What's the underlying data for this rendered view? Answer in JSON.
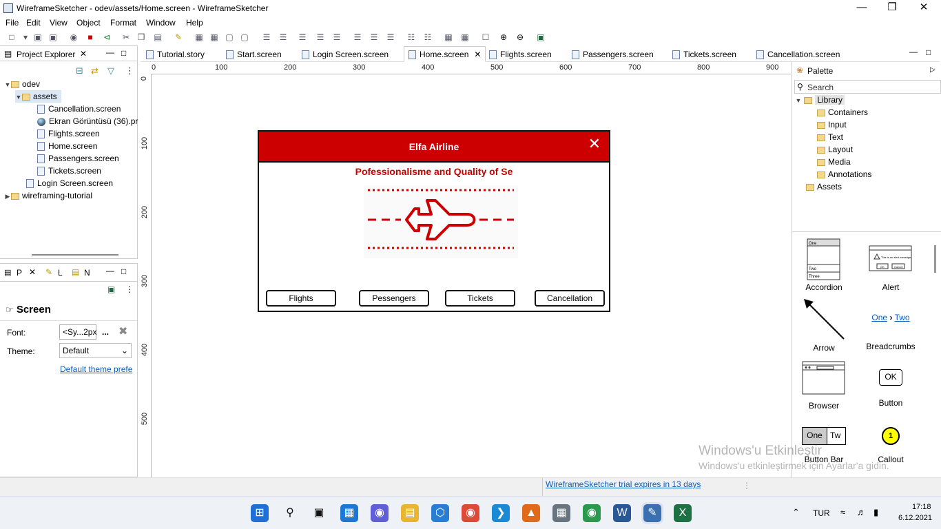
{
  "window": {
    "title": "WireframeSketcher - odev/assets/Home.screen - WireframeSketcher"
  },
  "menu": [
    "File",
    "Edit",
    "View",
    "Object",
    "Format",
    "Window",
    "Help"
  ],
  "project_explorer": {
    "title": "Project Explorer",
    "root": "odev",
    "folder": "assets",
    "files": [
      "Cancellation.screen",
      "Ekran Görüntüsü (36).pr",
      "Flights.screen",
      "Home.screen",
      "Passengers.screen",
      "Tickets.screen"
    ],
    "login": "Login Screen.screen",
    "other_project": "wireframing-tutorial"
  },
  "properties": {
    "tabs": [
      "P",
      "L",
      "N"
    ],
    "header": "Screen",
    "font_label": "Font:",
    "font_value": "<Sy...2px",
    "font_more": "...",
    "theme_label": "Theme:",
    "theme_value": "Default",
    "theme_link": "Default theme prefe"
  },
  "editor_tabs": [
    "Tutorial.story",
    "Start.screen",
    "Login Screen.screen",
    "Home.screen",
    "Flights.screen",
    "Passengers.screen",
    "Tickets.screen",
    "Cancellation.screen"
  ],
  "active_tab": "Home.screen",
  "ruler": {
    "h": [
      "0",
      "100",
      "200",
      "300",
      "400",
      "500",
      "600",
      "700",
      "800",
      "900"
    ],
    "v": [
      "0",
      "100",
      "200",
      "300",
      "400",
      "500"
    ]
  },
  "wireframe": {
    "title": "Elfa Airline",
    "subtitle": "Pofessionalisme and Quality of Se",
    "buttons": [
      "Flights",
      "Pessengers",
      "Tickets",
      "Cancellation"
    ]
  },
  "palette": {
    "title": "Palette",
    "search_placeholder": "Search",
    "library": "Library",
    "categories": [
      "Containers",
      "Input",
      "Text",
      "Layout",
      "Media",
      "Annotations"
    ],
    "assets": "Assets",
    "items": [
      "Accordion",
      "Alert",
      "Arrow",
      "Breadcrumbs",
      "Browser",
      "Button",
      "Button Bar",
      "Callout"
    ],
    "breadcrumb_one": "One",
    "breadcrumb_two": "Two",
    "button_ok": "OK",
    "buttonbar_one": "One",
    "buttonbar_two": "Tw",
    "callout_number": "1",
    "accordion_rows": [
      "One",
      "Two",
      "Three"
    ],
    "alert_text": "This is an alert message",
    "alert_ok": "OK",
    "alert_cancel": "Cancel"
  },
  "status": {
    "trial": "WireframeSketcher trial expires in 13 days",
    "watermark_title": "Windows'u Etkinleştir",
    "watermark_sub": "Windows'u etkinleştirmek için Ayarlar'a gidin."
  },
  "taskbar": {
    "lang": "TUR",
    "time": "17:18",
    "date": "6.12.2021"
  },
  "colors": {
    "accent": "#cc0000",
    "link": "#0b5fc0"
  }
}
